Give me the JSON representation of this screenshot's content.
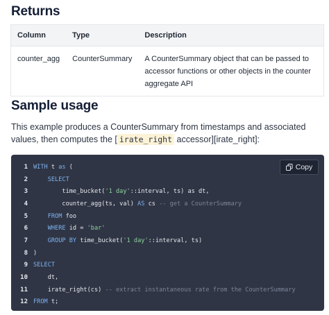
{
  "returns": {
    "heading": "Returns",
    "columns": [
      "Column",
      "Type",
      "Description"
    ],
    "rows": [
      {
        "column": "counter_agg",
        "type": "CounterSummary",
        "description": "A CounterSummary object that can be passed to accessor functions or other objects in the counter aggregate API"
      }
    ]
  },
  "usage": {
    "heading": "Sample usage",
    "intro_before": "This example produces a CounterSummary from timestamps and associated values, then computes the [",
    "intro_code": "irate_right",
    "intro_after": " accessor][irate_right]:"
  },
  "code_block": {
    "copy_label": "Copy",
    "copy_icon": "copy-icon",
    "lines": [
      {
        "n": "1",
        "parts": [
          [
            "kw",
            "WITH"
          ],
          [
            "",
            " t "
          ],
          [
            "kw",
            "as"
          ],
          [
            "",
            " ("
          ]
        ]
      },
      {
        "n": "2",
        "parts": [
          [
            "",
            "    "
          ],
          [
            "kw",
            "SELECT"
          ]
        ]
      },
      {
        "n": "3",
        "parts": [
          [
            "",
            "        time_bucket("
          ],
          [
            "str",
            "'1 day'"
          ],
          [
            "",
            "::interval, ts) as dt,"
          ]
        ]
      },
      {
        "n": "4",
        "parts": [
          [
            "",
            "        counter_agg(ts, val) "
          ],
          [
            "kw",
            "AS"
          ],
          [
            "",
            " cs "
          ],
          [
            "cm",
            "-- get a CounterSummary"
          ]
        ]
      },
      {
        "n": "5",
        "parts": [
          [
            "",
            "    "
          ],
          [
            "kw",
            "FROM"
          ],
          [
            "",
            " foo"
          ]
        ]
      },
      {
        "n": "6",
        "parts": [
          [
            "",
            "    "
          ],
          [
            "kw",
            "WHERE"
          ],
          [
            "",
            " id = "
          ],
          [
            "str",
            "'bar'"
          ]
        ]
      },
      {
        "n": "7",
        "parts": [
          [
            "",
            "    "
          ],
          [
            "kw",
            "GROUP BY"
          ],
          [
            "",
            " time_bucket("
          ],
          [
            "str",
            "'1 day'"
          ],
          [
            "",
            "::interval, ts)"
          ]
        ]
      },
      {
        "n": "8",
        "parts": [
          [
            "",
            ")"
          ]
        ]
      },
      {
        "n": "9",
        "parts": [
          [
            "kw",
            "SELECT"
          ]
        ]
      },
      {
        "n": "10",
        "parts": [
          [
            "",
            "    dt,"
          ]
        ]
      },
      {
        "n": "11",
        "parts": [
          [
            "",
            "    irate_right(cs) "
          ],
          [
            "cm",
            "-- extract instantaneous rate from the CounterSummary"
          ]
        ]
      },
      {
        "n": "12",
        "parts": [
          [
            "kw",
            "FROM"
          ],
          [
            "",
            " t;"
          ]
        ]
      }
    ]
  }
}
